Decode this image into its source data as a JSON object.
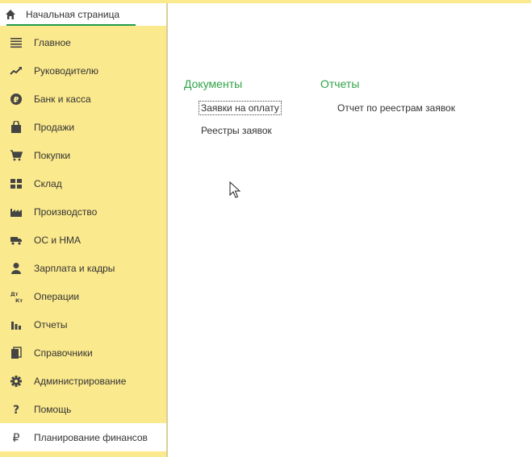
{
  "header": {
    "home_label": "Начальная страница"
  },
  "sidebar": {
    "items": [
      {
        "label": "Главное",
        "icon": "menu-lines-icon"
      },
      {
        "label": "Руководителю",
        "icon": "trend-icon"
      },
      {
        "label": "Банк и касса",
        "icon": "ruble-coin-icon"
      },
      {
        "label": "Продажи",
        "icon": "shopping-bag-icon"
      },
      {
        "label": "Покупки",
        "icon": "cart-icon"
      },
      {
        "label": "Склад",
        "icon": "warehouse-grid-icon"
      },
      {
        "label": "Производство",
        "icon": "factory-icon"
      },
      {
        "label": "ОС и НМА",
        "icon": "truck-icon"
      },
      {
        "label": "Зарплата и кадры",
        "icon": "person-icon"
      },
      {
        "label": "Операции",
        "icon": "dt-kt-icon"
      },
      {
        "label": "Отчеты",
        "icon": "bar-chart-icon"
      },
      {
        "label": "Справочники",
        "icon": "books-icon"
      },
      {
        "label": "Администрирование",
        "icon": "gear-icon"
      },
      {
        "label": "Помощь",
        "icon": "question-icon"
      },
      {
        "label": "Планирование финансов",
        "icon": "ruble-sign-icon"
      }
    ],
    "active_index": 14
  },
  "main": {
    "documents": {
      "title": "Документы",
      "links": [
        "Заявки на оплату",
        "Реестры заявок"
      ]
    },
    "reports": {
      "title": "Отчеты",
      "links": [
        "Отчет по реестрам заявок"
      ]
    }
  },
  "colors": {
    "sidebar_bg": "#fbe98d",
    "section_title": "#2ea346",
    "active_underline": "#1f9b4a"
  }
}
